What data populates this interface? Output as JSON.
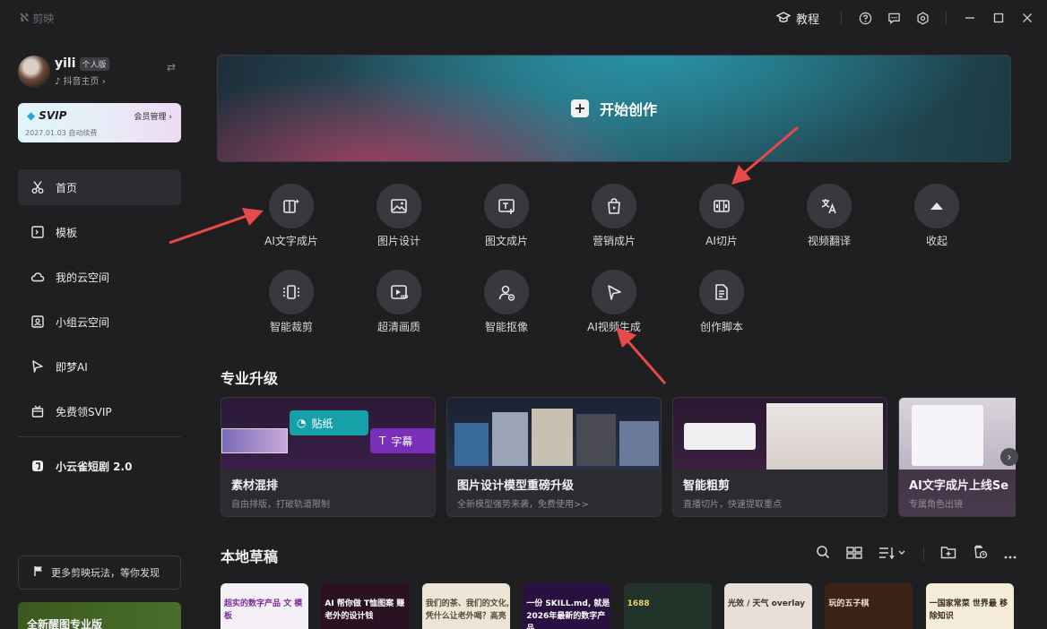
{
  "app": {
    "name": "剪映"
  },
  "titlebar": {
    "tutorial_label": "教程"
  },
  "user": {
    "name": "yili",
    "badge": "个人版",
    "link": "抖音主页"
  },
  "svip": {
    "title": "SVIP",
    "manage": "会员管理",
    "detail": "2027.01.03 自动续费"
  },
  "nav": {
    "items": [
      {
        "label": "首页",
        "icon": "scissors-icon"
      },
      {
        "label": "模板",
        "icon": "template-icon"
      },
      {
        "label": "我的云空间",
        "icon": "cloud-icon"
      },
      {
        "label": "小组云空间",
        "icon": "group-cloud-icon"
      },
      {
        "label": "即梦AI",
        "icon": "star-icon"
      },
      {
        "label": "免费领SVIP",
        "icon": "gift-icon"
      },
      {
        "label": "小云雀短剧 2.0",
        "icon": "app-icon"
      }
    ]
  },
  "promo": {
    "label": "更多剪映玩法，等你发现"
  },
  "banner": {
    "label": "全新醒图专业版"
  },
  "hero": {
    "label": "开始创作"
  },
  "tools": [
    {
      "label": "AI文字成片",
      "icon": "ai-text-video-icon"
    },
    {
      "label": "图片设计",
      "icon": "image-design-icon"
    },
    {
      "label": "图文成片",
      "icon": "image-text-video-icon"
    },
    {
      "label": "营销成片",
      "icon": "marketing-bag-icon"
    },
    {
      "label": "AI切片",
      "icon": "ai-slice-icon"
    },
    {
      "label": "视频翻译",
      "icon": "translate-icon"
    },
    {
      "label": "收起",
      "icon": "collapse-up-icon"
    },
    {
      "label": "智能裁剪",
      "icon": "smart-crop-icon"
    },
    {
      "label": "超清画质",
      "icon": "hd-quality-icon"
    },
    {
      "label": "智能抠像",
      "icon": "cutout-person-icon"
    },
    {
      "label": "AI视频生成",
      "icon": "ai-video-generate-icon"
    },
    {
      "label": "创作脚本",
      "icon": "script-doc-icon"
    }
  ],
  "pro_section": {
    "title": "专业升级"
  },
  "cards": [
    {
      "title": "素材混排",
      "subtitle": "自由排版，打破轨道限制",
      "tag1": "贴纸",
      "tag2": "字幕"
    },
    {
      "title": "图片设计模型重磅升级",
      "subtitle": "全新模型强势来袭，免费使用>>"
    },
    {
      "title": "智能粗剪",
      "subtitle": "直播切片，快速提取重点"
    },
    {
      "title": "AI文字成片上线Se",
      "subtitle": "专属角色出镜"
    }
  ],
  "drafts_section": {
    "title": "本地草稿"
  },
  "drafts": [
    {
      "text": "超实的数字产品 文 模板",
      "bg": "#f4f0f6",
      "fg": "#7a2c9a"
    },
    {
      "text": "AI 帮你做 T恤图案 赚老外的设计钱",
      "bg": "#2a1222",
      "fg": "#ffffff"
    },
    {
      "text": "我们的茶、我们的文化, 凭什么让老外喝？高亮",
      "bg": "#ede6d8",
      "fg": "#5a4a32"
    },
    {
      "text": "一份 SKILL.md, 就是 2026年最新的数字产品",
      "bg": "#2a1040",
      "fg": "#ffffff"
    },
    {
      "text": "1688",
      "bg": "#22342a",
      "fg": "#f0d070"
    },
    {
      "text": "光效 / 天气 overlay",
      "bg": "#e6e0d8",
      "fg": "#3a3028"
    },
    {
      "text": "玩的五子棋",
      "bg": "#3a2418",
      "fg": "#f3e2c6"
    },
    {
      "text": "一国家常菜 世界最 移除知识",
      "bg": "#f4ecd8",
      "fg": "#3a2818"
    }
  ]
}
